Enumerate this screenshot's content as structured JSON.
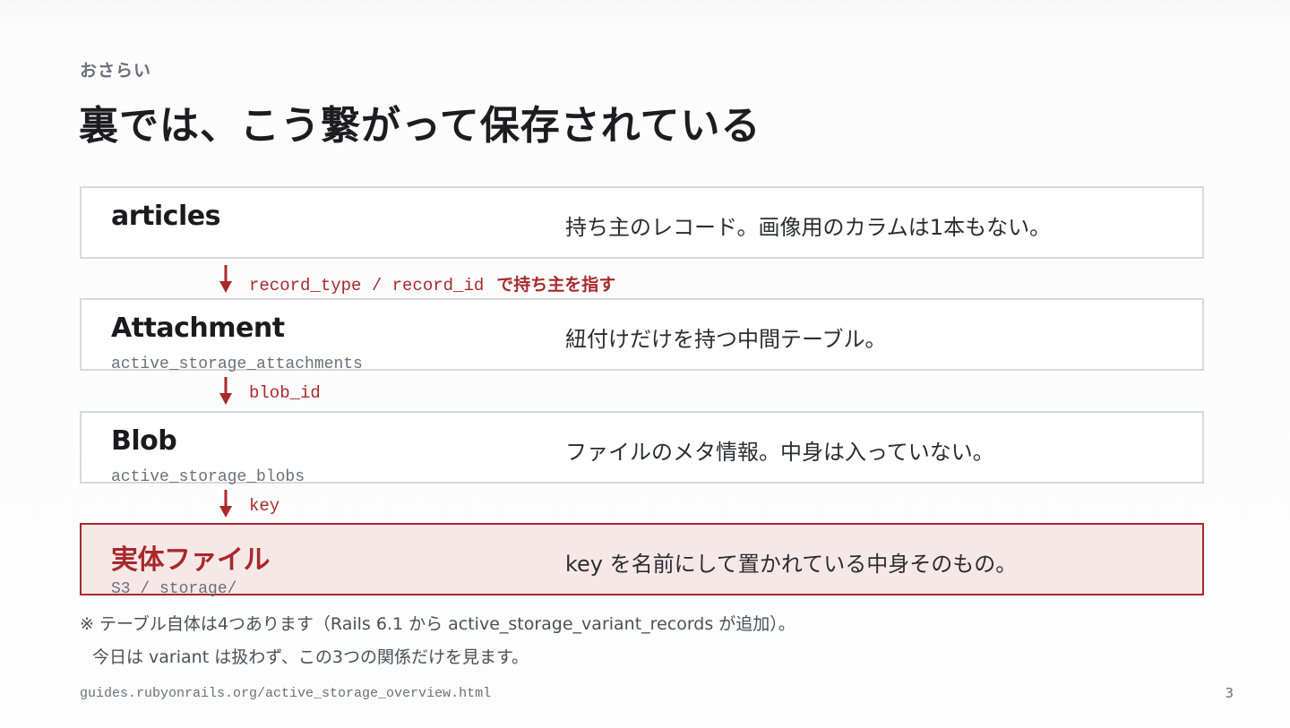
{
  "header": {
    "eyebrow": "おさらい",
    "title": "裏では、こう繋がって保存されている"
  },
  "boxes": [
    {
      "name": "articles",
      "table": "",
      "description": "持ち主のレコード。画像用のカラムは1本もない。",
      "highlighted": false
    },
    {
      "name": "Attachment",
      "table": "active_storage_attachments",
      "description": "紐付けだけを持つ中間テーブル。",
      "highlighted": false
    },
    {
      "name": "Blob",
      "table": "active_storage_blobs",
      "description": "ファイルのメタ情報。中身は入っていない。",
      "highlighted": false
    },
    {
      "name": "実体ファイル",
      "table": "S3 / storage/",
      "description": "key を名前にして置かれている中身そのもの。",
      "highlighted": true
    }
  ],
  "connectors": [
    {
      "code": "record_type / record_id",
      "text": "で持ち主を指す"
    },
    {
      "code": "blob_id",
      "text": ""
    },
    {
      "code": "key",
      "text": ""
    }
  ],
  "notes": {
    "line1": "※ テーブル自体は4つあります（Rails 6.1 から active_storage_variant_records が追加）。",
    "line2": "今日は variant は扱わず、この3つの関係だけを見ます。"
  },
  "footer": {
    "url": "guides.rubyonrails.org/active_storage_overview.html",
    "page_number": "3"
  },
  "colors": {
    "accent": "#a8292c",
    "box_border": "#d6d8dc",
    "highlight_background": "#f7e8e8",
    "muted_text": "#6b6f7a"
  }
}
